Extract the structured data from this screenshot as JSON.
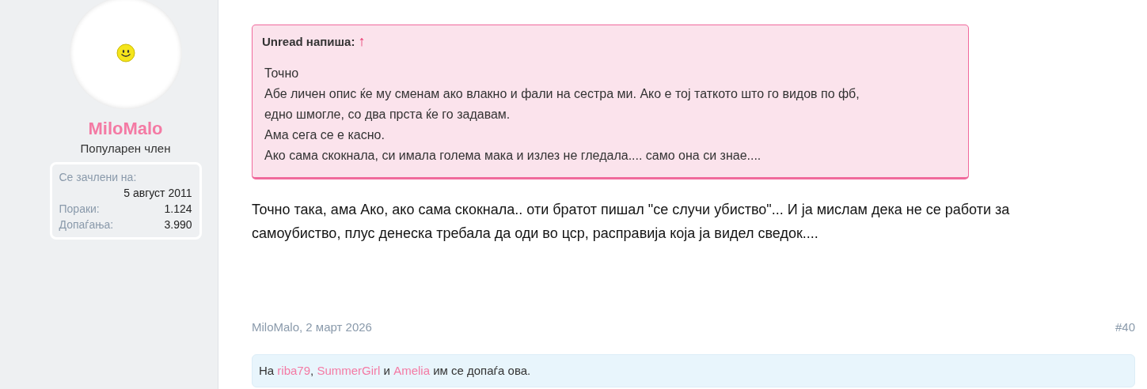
{
  "user": {
    "name": "MiloMalo",
    "title": "Популарен член",
    "stats": [
      {
        "label": "Се зачлени на:",
        "value": "5 август 2011",
        "kind": "stacked"
      },
      {
        "label": "Пораки:",
        "value": "1.124",
        "kind": "inline"
      },
      {
        "label": "Допаѓања:",
        "value": "3.990",
        "kind": "inline"
      }
    ]
  },
  "quote": {
    "author": "Unread напиша:",
    "arrow": "↑",
    "lines": [
      "Точно",
      "Абе личен опис ќе му сменам ако влакно и фали на сестра ми. Ако е тој таткото што го видов по фб,",
      "едно шмогле, со два прста ќе го задавам.",
      "Ама сега се е касно.",
      "Ако сама скокнала, си имала голема мака и излез не гледала.... само она си знае...."
    ]
  },
  "message": "Точно така, ама Ако, ако сама скокнала.. оти братот пишал \"се случи убиство\"... И ја мислам дека не се работи за самоубиство, плус денеска требала да оди во цср, расправија која ја видел сведок....",
  "footer": {
    "byline": "MiloMalo, 2 март 2026",
    "post_number": "#40"
  },
  "likes": [
    {
      "kind": "text",
      "text": "На "
    },
    {
      "kind": "link",
      "text": "riba79"
    },
    {
      "kind": "text",
      "text": ", "
    },
    {
      "kind": "link",
      "text": "SummerGirl"
    },
    {
      "kind": "text",
      "text": " и "
    },
    {
      "kind": "link",
      "text": "Amelia"
    },
    {
      "kind": "text",
      "text": " им се допаѓа ова."
    }
  ]
}
